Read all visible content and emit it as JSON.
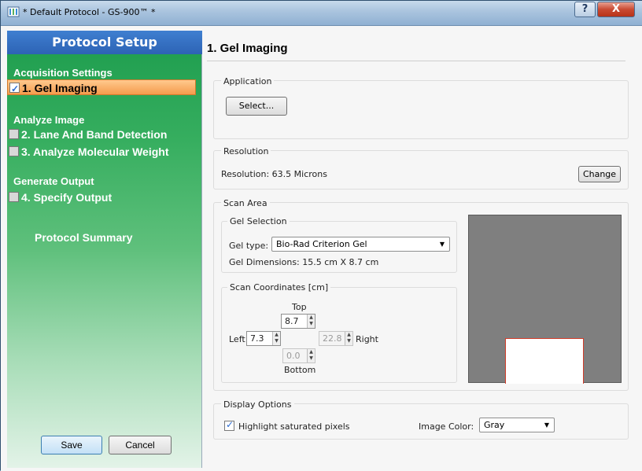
{
  "window": {
    "title": "* Default Protocol - GS-900™ *",
    "help_label": "?",
    "close_label": "X"
  },
  "sidebar": {
    "header": "Protocol Setup",
    "sections": [
      {
        "label": "Acquisition Settings"
      },
      {
        "label": "Analyze Image"
      },
      {
        "label": "Generate Output"
      }
    ],
    "items": [
      {
        "label": "1. Gel Imaging",
        "checked": true,
        "active": true
      },
      {
        "label": "2. Lane And Band Detection",
        "checked": false,
        "active": false
      },
      {
        "label": "3. Analyze Molecular Weight",
        "checked": false,
        "active": false
      },
      {
        "label": "4. Specify Output",
        "checked": false,
        "active": false
      }
    ],
    "summary": "Protocol Summary",
    "save_label": "Save",
    "cancel_label": "Cancel"
  },
  "main": {
    "title": "1. Gel Imaging",
    "application": {
      "label": "Application",
      "select_button": "Select..."
    },
    "resolution": {
      "label": "Resolution",
      "text": "Resolution:  63.5  Microns",
      "change_button": "Change"
    },
    "scan_area": {
      "label": "Scan Area",
      "gel_selection": {
        "label": "Gel Selection",
        "gel_type_label": "Gel type:",
        "gel_type_value": "Bio-Rad Criterion Gel",
        "dimensions_text": "Gel Dimensions:  15.5 cm X 8.7 cm"
      },
      "coordinates": {
        "label": "Scan Coordinates [cm]",
        "top_label": "Top",
        "top_value": "8.7",
        "left_label": "Left",
        "left_value": "7.3",
        "right_label": "Right",
        "right_value": "22.8",
        "bottom_label": "Bottom",
        "bottom_value": "0.0"
      }
    },
    "display_options": {
      "label": "Display Options",
      "highlight_label": "Highlight saturated pixels",
      "highlight_checked": true,
      "image_color_label": "Image Color:",
      "image_color_value": "Gray"
    }
  },
  "colors": {
    "sidebar_header": "#2d63b5",
    "active_item": "#f59b4c",
    "preview_background": "#7f7f7f",
    "preview_outline": "#d23c2a"
  }
}
